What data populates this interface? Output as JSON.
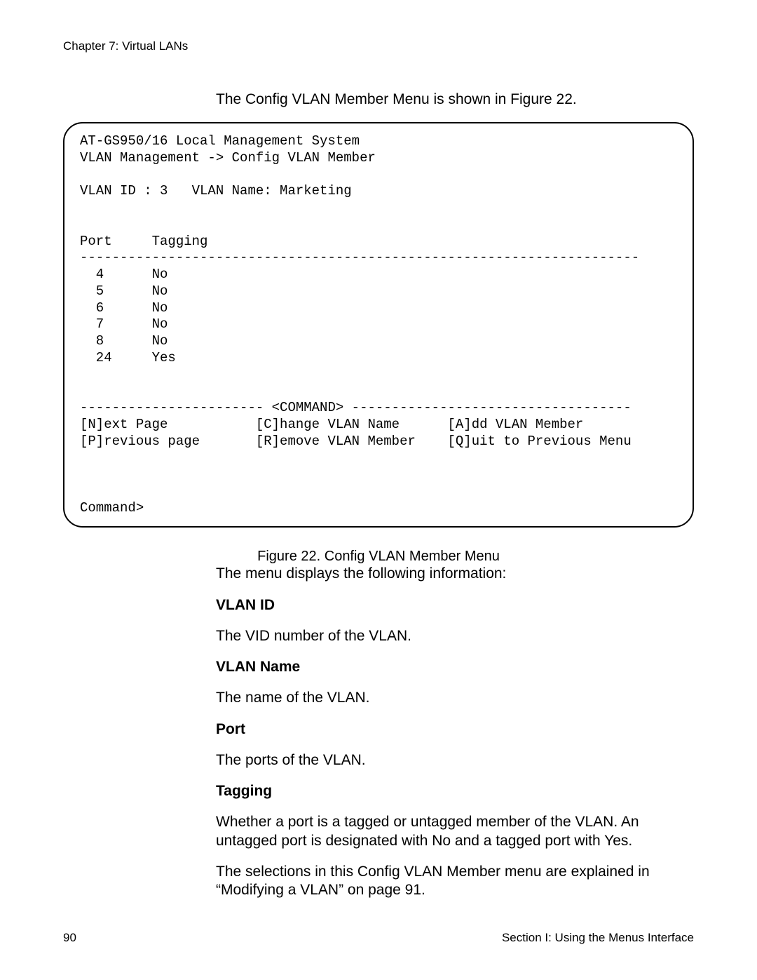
{
  "header": {
    "chapter": "Chapter 7: Virtual LANs"
  },
  "intro": "The Config VLAN Member Menu is shown in Figure 22.",
  "terminal": {
    "line1": "AT-GS950/16 Local Management System",
    "line2": "VLAN Management -> Config VLAN Member",
    "line3": "",
    "vlan_line": "VLAN ID : 3   VLAN Name: Marketing",
    "blank1": "",
    "blank2": "",
    "table_header": "Port     Tagging",
    "rule": "----------------------------------------------------------------------",
    "rows": [
      "  4      No",
      "  5      No",
      "  6      No",
      "  7      No",
      "  8      No",
      "  24     Yes"
    ],
    "blank3": "",
    "blank4": "",
    "cmd_rule": "----------------------- <COMMAND> -----------------------------------",
    "cmd_row1": "[N]ext Page           [C]hange VLAN Name      [A]dd VLAN Member",
    "cmd_row2": "[P]revious page       [R]emove VLAN Member    [Q]uit to Previous Menu",
    "blank5": "",
    "blank6": "",
    "blank7": "",
    "prompt": "Command>"
  },
  "figure_caption": "Figure 22. Config VLAN Member Menu",
  "body": {
    "intro2": "The menu displays the following information:",
    "defs": [
      {
        "term": "VLAN ID",
        "desc": "The VID number of the VLAN."
      },
      {
        "term": "VLAN Name",
        "desc": "The name of the VLAN."
      },
      {
        "term": "Port",
        "desc": "The ports of the VLAN."
      },
      {
        "term": "Tagging",
        "desc": "Whether a port is a tagged or untagged member of the VLAN. An untagged port is designated with No and a tagged port with Yes."
      }
    ],
    "closing": "The selections in this Config VLAN Member menu are explained in “Modifying a VLAN” on page 91."
  },
  "footer": {
    "page": "90",
    "section": "Section I: Using the Menus Interface"
  }
}
